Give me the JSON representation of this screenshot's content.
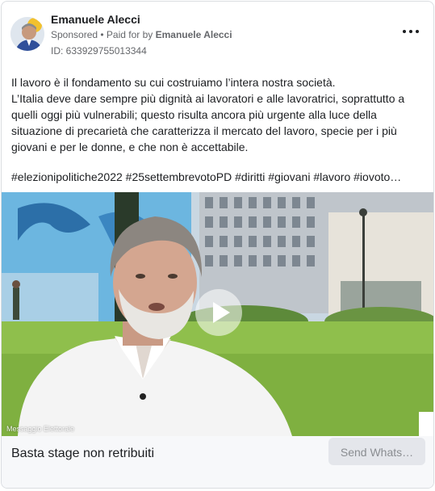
{
  "ad": {
    "advertiser_name": "Emanuele Alecci",
    "sponsored_label": "Sponsored",
    "separator": " • ",
    "paid_for_prefix": "Paid for by ",
    "paid_for_name": "Emanuele Alecci",
    "ad_id": "ID: 633929755013344",
    "more_icon": "ellipsis-icon"
  },
  "body": {
    "line1": "Il lavoro è il fondamento su cui costruiamo l’intera nostra società.",
    "line2": "L’Italia deve dare sempre più dignità ai lavoratori e alle lavoratrici, soprattutto a quelli oggi più vulnerabili; questo risulta ancora più urgente alla luce della situazione di precarietà che caratterizza il mercato del lavoro, specie per i più giovani e per le donne, e che non è accettabile.",
    "hashtags": "#elezionipolitiche2022 #25settembrevotoPD #diritti #giovani #lavoro #iovoto…"
  },
  "media": {
    "play_icon": "play-icon",
    "watermark": "Messaggio Elettorale"
  },
  "footer": {
    "title": "Basta stage non retribuiti",
    "cta_label": "Send Whats…"
  }
}
